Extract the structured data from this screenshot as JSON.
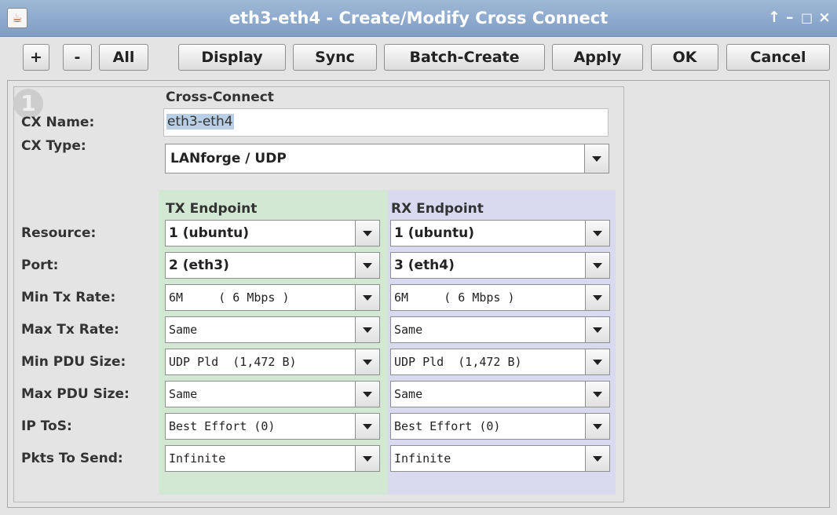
{
  "window": {
    "title": "eth3-eth4 - Create/Modify Cross Connect",
    "controls": [
      "↑",
      "–",
      "□",
      "×"
    ]
  },
  "toolbar": {
    "add": "+",
    "remove": "-",
    "all": "All",
    "display": "Display",
    "sync": "Sync",
    "batch_create": "Batch-Create",
    "apply": "Apply",
    "ok": "OK",
    "cancel": "Cancel"
  },
  "form": {
    "badge": "1",
    "section_title": "Cross-Connect",
    "cx_name_label": "CX Name:",
    "cx_name_value": "eth3-eth4",
    "cx_type_label": "CX Type:",
    "cx_type_value": "LANforge / UDP",
    "tx_header": "TX Endpoint",
    "rx_header": "RX Endpoint",
    "rows": [
      {
        "label": "Resource:",
        "tx": "1 (ubuntu)",
        "rx": "1 (ubuntu)",
        "style": "bold"
      },
      {
        "label": "Port:",
        "tx": "2 (eth3)",
        "rx": "3 (eth4)",
        "style": "bold"
      },
      {
        "label": "Min Tx Rate:",
        "tx": "6M     ( 6 Mbps )",
        "rx": "6M     ( 6 Mbps )",
        "style": "mono"
      },
      {
        "label": "Max Tx Rate:",
        "tx": "Same",
        "rx": "Same",
        "style": "mono"
      },
      {
        "label": "Min PDU Size:",
        "tx": "UDP Pld  (1,472 B)",
        "rx": "UDP Pld  (1,472 B)",
        "style": "mono"
      },
      {
        "label": "Max PDU Size:",
        "tx": "Same",
        "rx": "Same",
        "style": "mono"
      },
      {
        "label": "IP ToS:",
        "tx": "Best Effort (0)",
        "rx": "Best Effort (0)",
        "style": "mono"
      },
      {
        "label": "Pkts To Send:",
        "tx": "Infinite",
        "rx": "Infinite",
        "style": "mono"
      }
    ]
  }
}
